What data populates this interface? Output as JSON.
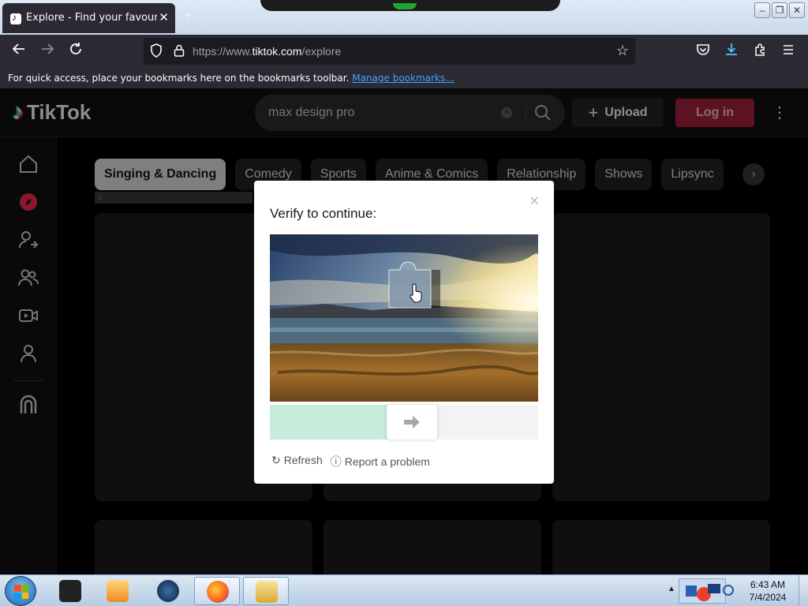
{
  "browser": {
    "tab_title": "Explore - Find your favourite vi",
    "tab_close": "✕",
    "new_tab": "+",
    "url_prefix": "https://www.",
    "url_domain": "tiktok.com",
    "url_path": "/explore",
    "bookmarks_text": "For quick access, place your bookmarks here on the bookmarks toolbar.",
    "bookmarks_link": "Manage bookmarks..."
  },
  "tiktok": {
    "logo_text": "TikTok",
    "search_value": "max design pro",
    "upload_label": "Upload",
    "login_label": "Log in",
    "categories": [
      "Singing & Dancing",
      "Comedy",
      "Sports",
      "Anime & Comics",
      "Relationship",
      "Shows",
      "Lipsync"
    ]
  },
  "captcha": {
    "heading": "Verify to continue:",
    "refresh_label": "Refresh",
    "report_label": "Report a problem",
    "slider_progress": 0.44
  },
  "taskbar": {
    "time": "6:43 AM",
    "date": "7/4/2024"
  },
  "colors": {
    "tiktok_red": "#a8213b",
    "accent_cyan": "#25f4ee",
    "accent_pink": "#fe2c55",
    "slider_fill": "#c6ecdc"
  }
}
